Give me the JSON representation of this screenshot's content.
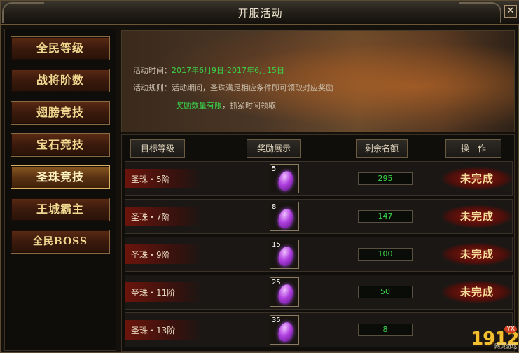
{
  "window": {
    "title": "开服活动",
    "close_label": "✕"
  },
  "sidebar": {
    "items": [
      {
        "label": "全民等级"
      },
      {
        "label": "战将阶数"
      },
      {
        "label": "翅膀竞技"
      },
      {
        "label": "宝石竞技"
      },
      {
        "label": "圣珠竞技"
      },
      {
        "label": "王城霸主"
      },
      {
        "label": "全民BOSS"
      }
    ],
    "active_index": 4
  },
  "banner": {
    "time_label": "活动时间：",
    "time_value": "2017年6月9日-2017年6月15日",
    "rule_label": "活动规则：",
    "rule_text": "活动期间，圣珠满足相应条件即可领取对应奖励",
    "limit_text": "奖励数量有限",
    "limit_suffix": "，抓紧时间领取"
  },
  "table": {
    "headers": [
      "目标等级",
      "奖励展示",
      "剩余名额",
      "操　作"
    ],
    "rows": [
      {
        "target": "圣珠・5阶",
        "reward_qty": "5",
        "reward_icon": "purple-pearl-icon",
        "remaining": "295",
        "status": "未完成"
      },
      {
        "target": "圣珠・7阶",
        "reward_qty": "8",
        "reward_icon": "purple-pearl-icon",
        "remaining": "147",
        "status": "未完成"
      },
      {
        "target": "圣珠・9阶",
        "reward_qty": "15",
        "reward_icon": "purple-pearl-icon",
        "remaining": "100",
        "status": "未完成"
      },
      {
        "target": "圣珠・11阶",
        "reward_qty": "25",
        "reward_icon": "purple-pearl-icon",
        "remaining": "50",
        "status": "未完成"
      },
      {
        "target": "圣珠・13阶",
        "reward_qty": "35",
        "reward_icon": "purple-pearl-icon",
        "remaining": "8",
        "status": ""
      }
    ]
  },
  "watermark": {
    "number": "1912",
    "badge": "YX",
    "subtitle": "网页游戏"
  },
  "colors": {
    "accent_green": "#3ad44a",
    "gold_text": "#f0d890",
    "status_red": "#8a140a"
  }
}
